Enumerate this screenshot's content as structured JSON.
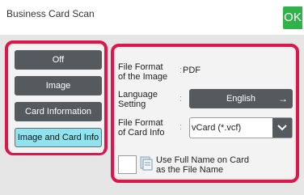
{
  "header": {
    "title": "Business Card Scan",
    "ok_label": "OK"
  },
  "modes": [
    {
      "label": "Off",
      "active": false
    },
    {
      "label": "Image",
      "active": false
    },
    {
      "label": "Card Information",
      "active": false
    },
    {
      "label": "Image and Card Info",
      "active": true
    }
  ],
  "settings": {
    "file_format_image": {
      "label_line1": "File Format",
      "label_line2": "of the Image",
      "colon": ":",
      "value": "PDF"
    },
    "language": {
      "label_line1": "Language",
      "label_line2": "Setting",
      "colon": ":",
      "value": "English",
      "arrow": "→"
    },
    "file_format_card": {
      "label_line1": "File Format",
      "label_line2": "of Card Info",
      "colon": ":",
      "value": "vCard (*.vcf)"
    },
    "use_full_name": {
      "label_line1": "Use Full Name on Card",
      "label_line2": "as the File Name",
      "checked": false
    }
  },
  "colors": {
    "highlight_frame": "#d8174b",
    "ok_button": "#2fb24a",
    "active_mode": "#8fe3ee",
    "button_dark": "#555a5e"
  },
  "icons": [
    "arrow-right-icon",
    "chevron-down-icon",
    "document-icon"
  ]
}
